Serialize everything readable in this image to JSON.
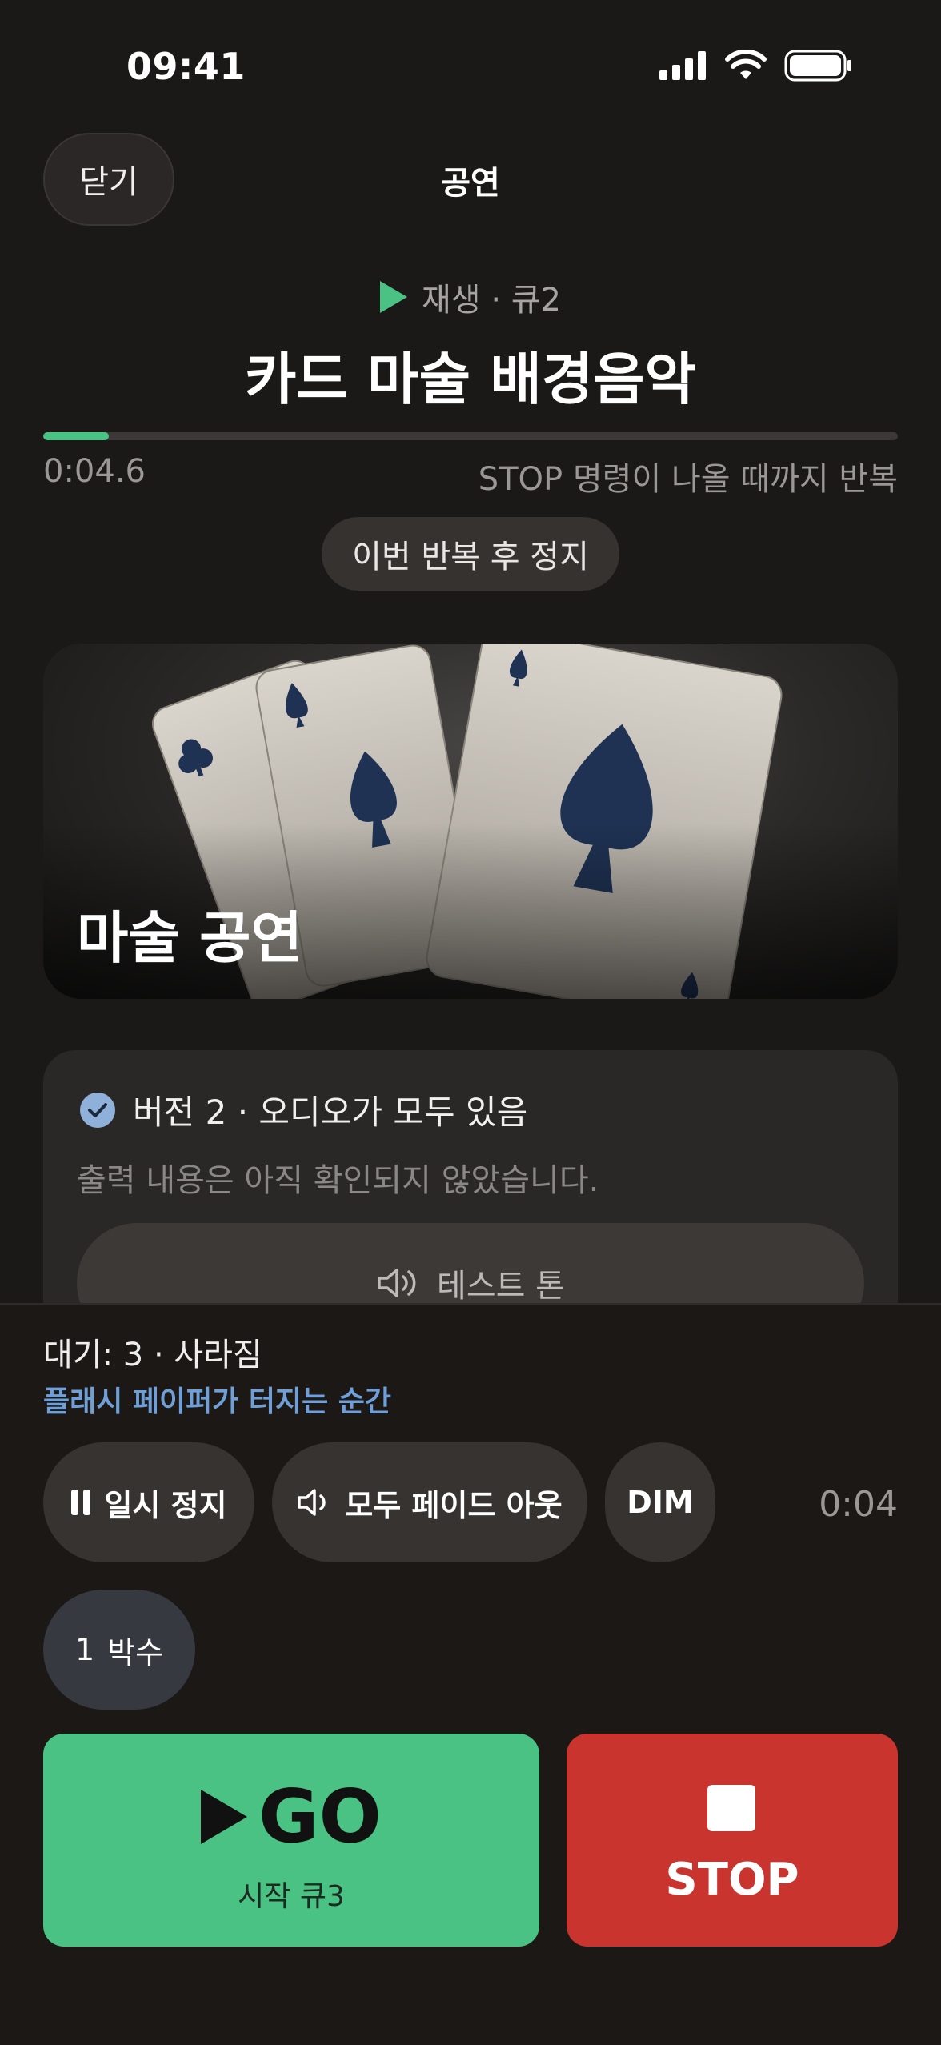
{
  "status_bar": {
    "time": "09:41"
  },
  "header": {
    "close_label": "닫기",
    "title": "공연"
  },
  "now_playing": {
    "status": "재생 · 큐2",
    "title": "카드 마술 배경음악",
    "progress": 0.077,
    "elapsed": "0:04.6",
    "loop_note": "STOP 명령이 나올 때까지 반복",
    "stop_after_label": "이번 반복 후 정지"
  },
  "hero": {
    "title": "마술 공연"
  },
  "version_card": {
    "version_line": "버전 2 · 오디오가 모두 있음",
    "subtitle": "출력 내용은 아직 확인되지 않았습니다.",
    "test_tone_label": "테스트 톤"
  },
  "standby": {
    "label": "대기: 3 · 사라짐",
    "cue_note": "플래시 페이퍼가 터지는 순간"
  },
  "controls": {
    "pause_label": "일시 정지",
    "fade_all_label": "모두 페이드 아웃",
    "dim_label": "DIM",
    "timer": "0:04",
    "beat_count": "1",
    "beat_label": "박수"
  },
  "go": {
    "label": "GO",
    "sub": "시작 큐3"
  },
  "stop": {
    "label": "STOP"
  },
  "colors": {
    "accent_green": "#4ac283",
    "stop_red": "#c9342e",
    "link_blue": "#6f9fd6"
  }
}
